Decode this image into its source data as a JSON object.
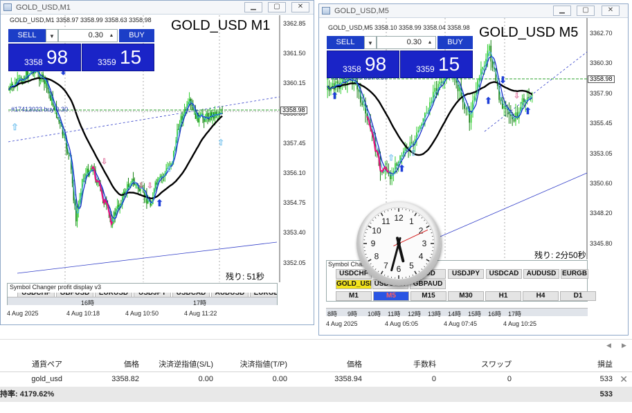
{
  "colors": {
    "bid_button": "#1c3ec7",
    "price_panel": "#1a24c7",
    "bull_candle": "#2ecc2e",
    "bear_candle": "#12800f",
    "ma_black": "#000000",
    "ma_blue": "#0a20c8",
    "ma_pink": "#e8107c",
    "current_price_line": "#2ea32e",
    "active_symbol": "#f2e31c",
    "active_tf": "#2a55e3"
  },
  "left": {
    "title": "GOLD_USD,M1",
    "header": "GOLD_USD,M1  3358.97 3358.99 3358.63 3358.98",
    "big_symbol": "GOLD_USD M1",
    "sell_label": "SELL",
    "buy_label": "BUY",
    "lot": "0.30",
    "sell_small": "3358",
    "sell_large": "98",
    "buy_small": "3359",
    "buy_large": "15",
    "order_label": "#17413023 buy 0.30",
    "yaxis": [
      "3362.85",
      "3361.50",
      "3360.15",
      "3358.80",
      "3357.45",
      "3356.10",
      "3354.75",
      "3353.40",
      "3352.05"
    ],
    "current_price": "3358.98",
    "remaining": "残り: 51秒",
    "panel_title": "Symbol Changer profit display v3",
    "hour_labels": [
      "16時",
      "17時"
    ],
    "xaxis": [
      "4 Aug 2025",
      "4 Aug 10:18",
      "4 Aug 10:50",
      "4 Aug 11:22"
    ],
    "cut_symbols": [
      "USDCHF",
      "GBPUSD",
      "EURUSD",
      "USDJPY",
      "USDCAD",
      "AUDUSD",
      "EURGBP"
    ]
  },
  "right": {
    "title": "GOLD_USD,M5",
    "header": "GOLD_USD,M5  3358.10 3358.99 3358.04 3358.98",
    "big_symbol": "GOLD_USD M5",
    "sell_label": "SELL",
    "buy_label": "BUY",
    "lot": "0.30",
    "sell_small": "3358",
    "sell_large": "98",
    "buy_small": "3359",
    "buy_large": "15",
    "order_label": "#17413023 buy 0.30",
    "yaxis": [
      "3362.70",
      "3360.30",
      "3357.90",
      "3355.45",
      "3353.05",
      "3350.60",
      "3348.20",
      "3345.80"
    ],
    "current_price": "3358.98",
    "remaining": "残り: 2分50秒",
    "panel_title": "Symbol Changer",
    "symbols_row1": [
      "USDCHF",
      "AUD",
      "USDJPY",
      "USDCAD",
      "AUDUSD",
      "EURGB"
    ],
    "symbols_row2": [
      "GOLD_USD",
      "USDOLLY",
      "GBPAUD"
    ],
    "timeframes": [
      "M1",
      "M5",
      "M15",
      "M30",
      "H1",
      "H4",
      "D1"
    ],
    "active_tf": "M5",
    "hour_labels": [
      "8時",
      "9時",
      "10時",
      "11時",
      "12時",
      "13時",
      "14時",
      "15時",
      "16時",
      "17時"
    ],
    "xaxis": [
      "4 Aug 2025",
      "4 Aug 05:05",
      "4 Aug 07:45",
      "4 Aug 10:25"
    ]
  },
  "clock": {
    "numbers": [
      "12",
      "1",
      "2",
      "3",
      "4",
      "5",
      "6",
      "7",
      "8",
      "9",
      "10",
      "11"
    ],
    "hour": 5.53,
    "minute": 32.5,
    "second": 10.8
  },
  "trade": {
    "columns": [
      "通貨ペア",
      "価格",
      "決済逆指値(S/L)",
      "決済指値(T/P)",
      "価格",
      "手数料",
      "スワップ",
      "損益"
    ],
    "row": [
      "gold_usd",
      "3358.82",
      "0.00",
      "0.00",
      "3358.94",
      "0",
      "0",
      "533"
    ],
    "total_label": "持率: 4179.62%",
    "total_value": "533"
  }
}
